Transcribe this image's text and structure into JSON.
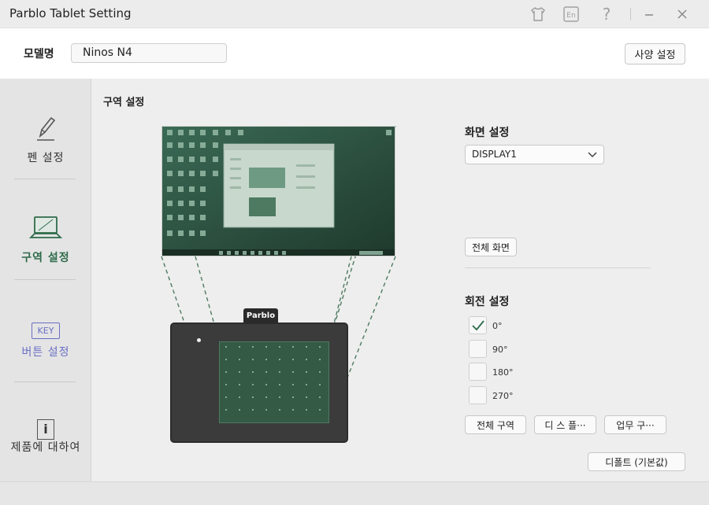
{
  "window": {
    "title": "Parblo Tablet Setting",
    "controls": [
      "shirt-icon",
      "language-icon",
      "help-icon",
      "minimize-icon",
      "close-icon"
    ],
    "language_badge": "En",
    "help_glyph": "?"
  },
  "model": {
    "label": "모델명",
    "value": "Ninos N4",
    "spec_button": "사양 설정"
  },
  "sidebar": {
    "items": [
      {
        "label": "펜 설정",
        "icon": "pen-icon",
        "active": false
      },
      {
        "label": "구역 설정",
        "icon": "laptop-icon",
        "active": true
      },
      {
        "label": "버튼 설정",
        "icon": "key-icon",
        "badge": "KEY",
        "active": false
      },
      {
        "label": "제품에 대하여",
        "icon": "info-icon",
        "badge": "i",
        "active": false
      }
    ]
  },
  "content": {
    "section_title": "구역 설정",
    "tablet_brand": "Parblo",
    "screen": {
      "title": "화면 설정",
      "selected_display": "DISPLAY1",
      "full_screen_button": "전체 화면"
    },
    "rotation": {
      "title": "회전 설정",
      "options": [
        {
          "label": "0°",
          "checked": true
        },
        {
          "label": "90°",
          "checked": false
        },
        {
          "label": "180°",
          "checked": false
        },
        {
          "label": "270°",
          "checked": false
        }
      ],
      "buttons": [
        "전체 구역",
        "디 스 플···",
        "업무 구···"
      ]
    },
    "default_button": "디폴트 (기본값)"
  },
  "colors": {
    "active_accent": "#2e6b4a",
    "inactive_button_text": "#6a6fc4",
    "tablet_body": "#3b3b3b",
    "active_area": "#345a45"
  }
}
